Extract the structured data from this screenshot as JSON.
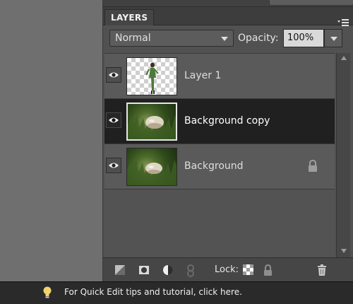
{
  "panel": {
    "tab_label": "LAYERS",
    "menu_icon": "panel-menu-icon"
  },
  "controls": {
    "blend_mode": "Normal",
    "opacity_label": "Opacity:",
    "opacity_value": "100%"
  },
  "layers": [
    {
      "name": "Layer 1",
      "visible": true,
      "selected": false,
      "locked": false,
      "thumbnail": "transparent-figure"
    },
    {
      "name": "Background copy",
      "visible": true,
      "selected": true,
      "locked": false,
      "thumbnail": "grass-scene"
    },
    {
      "name": "Background",
      "visible": true,
      "selected": false,
      "locked": true,
      "thumbnail": "grass-scene"
    }
  ],
  "bottom_toolbar": {
    "lock_label": "Lock:",
    "tools": [
      "new-layer-icon",
      "mask-icon",
      "adjustment-layer-icon",
      "link-icon",
      "lock-transparent-icon",
      "lock-all-icon",
      "trash-icon"
    ]
  },
  "status": {
    "tip": "For Quick Edit tips and tutorial, click here.",
    "icon": "lightbulb-icon"
  },
  "colors": {
    "panel_bg": "#515151",
    "selected_row": "#202020",
    "status_bg": "#2a2a2a"
  }
}
